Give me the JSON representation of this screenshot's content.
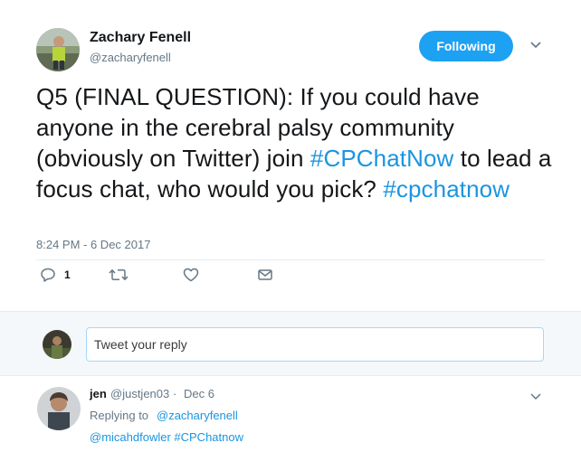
{
  "tweet": {
    "author_name": "Zachary Fenell",
    "author_handle": "@zacharyfenell",
    "follow_label": "Following",
    "text_part1": "Q5 (FINAL QUESTION): If you could have anyone in the cerebral palsy community (obviously on Twitter) join ",
    "hashtag1": "#CPChatNow",
    "text_part2": " to lead a focus chat, who would you pick? ",
    "hashtag2": "#cpchatnow",
    "timestamp": "8:24 PM - 6 Dec 2017",
    "reply_count": "1"
  },
  "reply_box": {
    "placeholder": "Tweet your reply"
  },
  "reply": {
    "name": "jen",
    "handle": "@justjen03",
    "dot": "·",
    "date": "Dec 6",
    "replying_to_label": "Replying to",
    "replying_to_handle": "@zacharyfenell",
    "text": "@micahdfowler #CPChatnow"
  },
  "colors": {
    "accent": "#1da1f2",
    "link": "#1b95e0",
    "muted": "#657786"
  }
}
